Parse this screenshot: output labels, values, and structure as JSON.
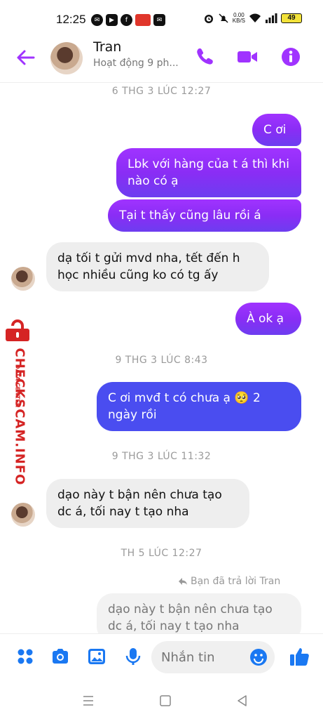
{
  "status_bar": {
    "time": "12:25",
    "net_speed_value": "0.00",
    "net_speed_unit": "KB/S",
    "battery": "49"
  },
  "header": {
    "contact_name": "Tran",
    "contact_status": "Hoạt động 9 ph..."
  },
  "messages": [
    {
      "type": "timestamp",
      "text": "6 THG 3 LÚC 12:27"
    },
    {
      "type": "outgoing",
      "text": "C ơi"
    },
    {
      "type": "outgoing",
      "text": "Lbk với hàng của t á thì khi nào có ạ"
    },
    {
      "type": "outgoing",
      "text": "Tại t thấy cũng lâu rồi á"
    },
    {
      "type": "incoming",
      "text": "dạ tối t gửi mvd nha, tết đến h học nhiều cũng ko có tg ấy"
    },
    {
      "type": "outgoing",
      "text": "À ok ạ"
    },
    {
      "type": "timestamp",
      "text": "9 THG 3 LÚC 8:43"
    },
    {
      "type": "outgoing",
      "text": "C ơi mvđ t có chưa ạ 🥺 2 ngày rồi"
    },
    {
      "type": "timestamp",
      "text": "9 THG 3 LÚC 11:32"
    },
    {
      "type": "incoming",
      "text": "dạo này t bận nên chưa tạo dc á, tối nay t tạo nha"
    },
    {
      "type": "timestamp",
      "text": "TH 5 LÚC 12:27"
    },
    {
      "type": "reply_label",
      "text": "Bạn đã trả lời Tran"
    },
    {
      "type": "quoted",
      "text": "dạo này t bận nên chưa tạo dc á, tối nay t tạo nha"
    }
  ],
  "composer": {
    "placeholder": "Nhắn tin"
  },
  "watermark": {
    "main": "CHECKSCAM.INFO",
    "sub": "DATA CENTER"
  },
  "colors": {
    "accent": "#a033ff",
    "outgoing_purple": "#8a2df5",
    "outgoing_blue": "#4a4df0",
    "incoming_bg": "#eeeeee",
    "composer_icons": "#1a78f2",
    "watermark_red": "#d52424"
  },
  "icons": [
    "back-arrow-icon",
    "phone-icon",
    "video-camera-icon",
    "info-icon",
    "menu-dots-icon",
    "camera-icon",
    "image-icon",
    "microphone-icon",
    "emoji-icon",
    "thumbs-up-icon",
    "reply-arrow-icon",
    "lock-icon",
    "recent-apps-icon",
    "home-icon",
    "back-triangle-icon"
  ]
}
